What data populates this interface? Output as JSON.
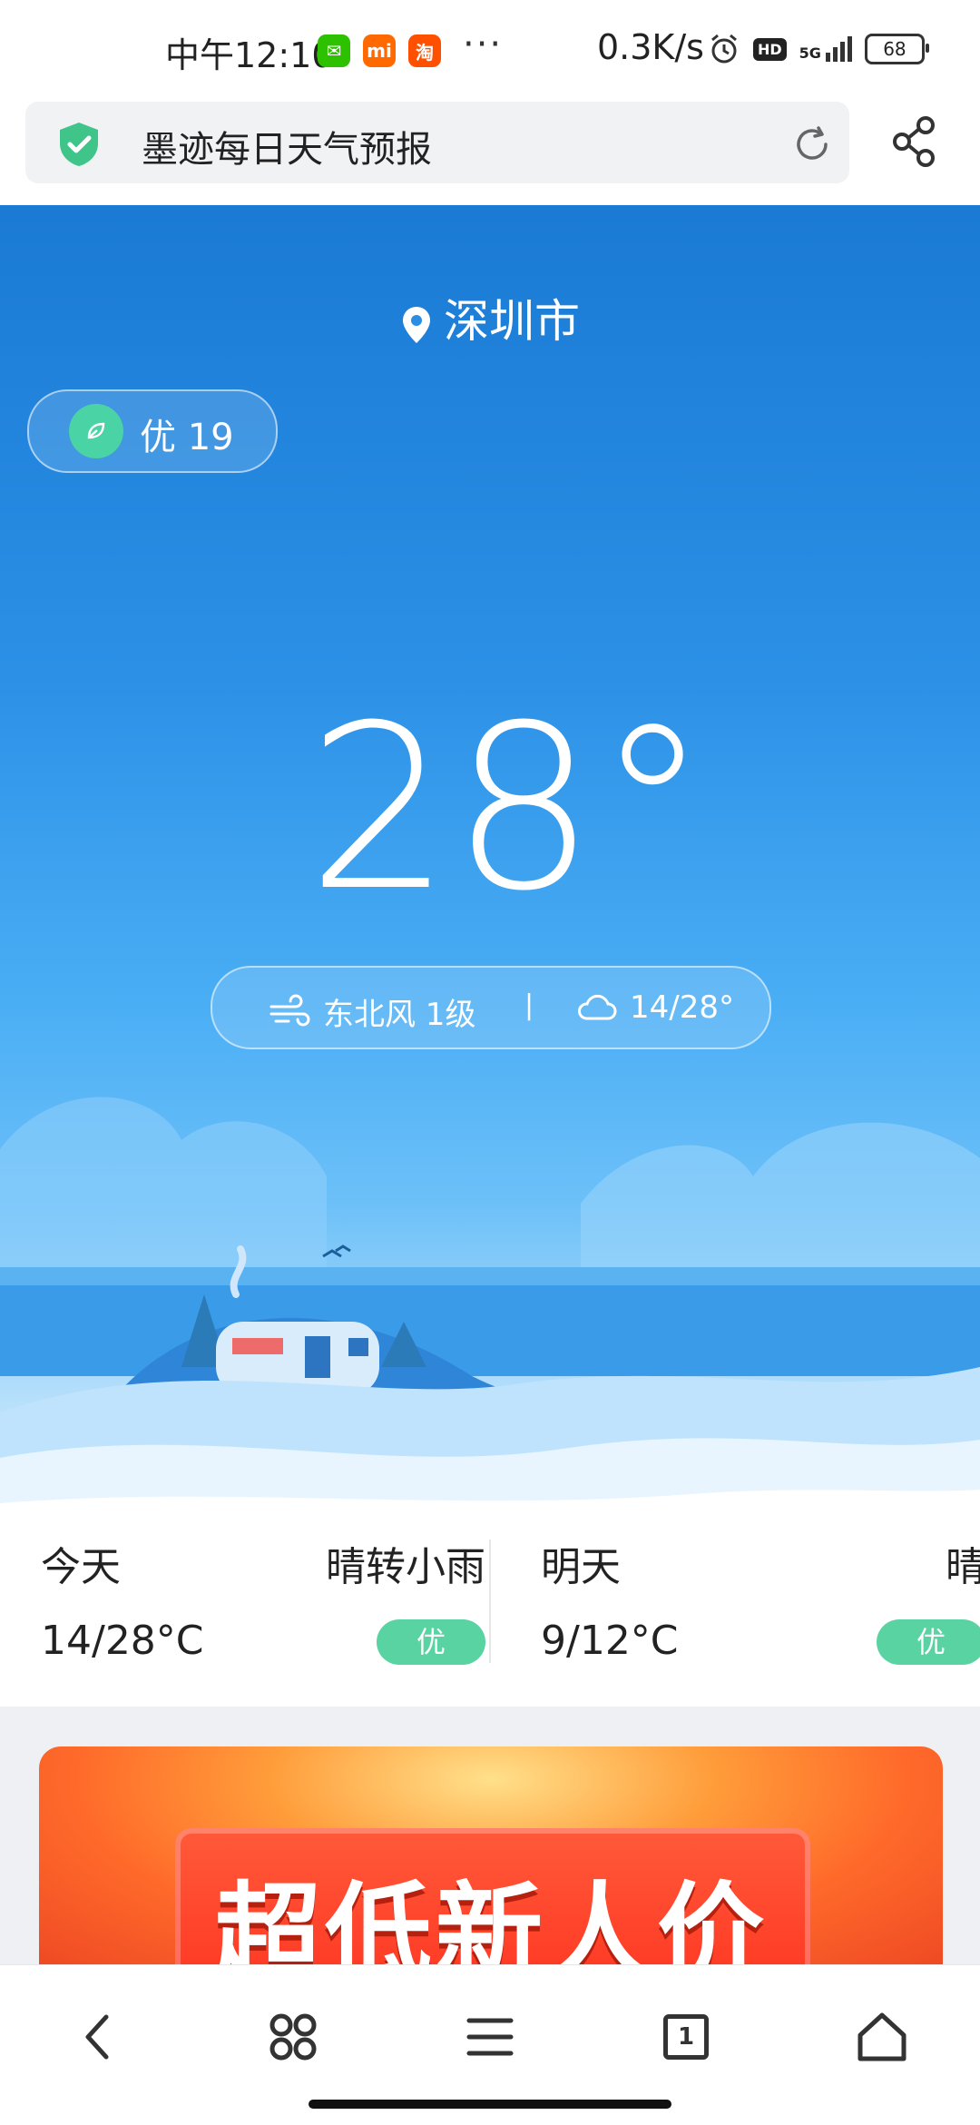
{
  "status_bar": {
    "time": "中午12:10",
    "dots": "···",
    "net_speed": "0.3K/s",
    "hd": "HD",
    "signal": "5G",
    "battery": "68",
    "apps": [
      {
        "name": "wechat-icon",
        "color": "#2dc100",
        "glyph": "✉"
      },
      {
        "name": "mi-icon",
        "color": "#ff6900",
        "glyph": "mi"
      },
      {
        "name": "taobao-icon",
        "color": "#ff5000",
        "glyph": "淘"
      }
    ]
  },
  "address_bar": {
    "title": "墨迹每日天气预报"
  },
  "hero": {
    "city": "深圳市",
    "aqi": "优 19",
    "temperature": "28°",
    "wind": "东北风 1级",
    "separator": "|",
    "temp_range": "14/28°"
  },
  "daily": {
    "today": {
      "name": "今天",
      "condition": "晴转小雨",
      "range": "14/28°C",
      "badge": "优"
    },
    "tomorrow": {
      "name": "明天",
      "condition": "晴",
      "range": "9/12°C",
      "badge": "优"
    }
  },
  "ad": {
    "text": "超低新人价"
  },
  "bottom_nav": {
    "tab_count": "1"
  },
  "colors": {
    "accent_green": "#5ad3a2",
    "sky_top": "#1a7ad4"
  }
}
